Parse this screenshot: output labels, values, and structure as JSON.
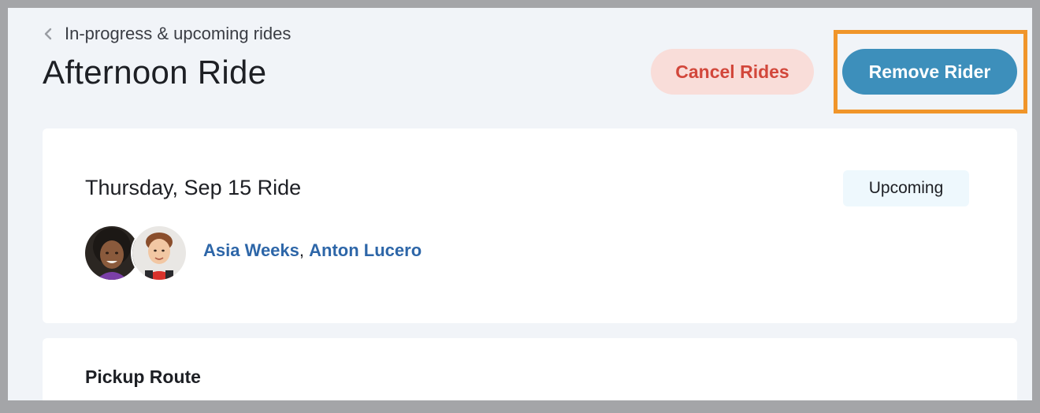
{
  "header": {
    "back_label": "In-progress & upcoming rides",
    "title": "Afternoon Ride"
  },
  "actions": {
    "cancel_label": "Cancel Rides",
    "remove_label": "Remove Rider"
  },
  "ride": {
    "date_title": "Thursday, Sep 15 Ride",
    "status": "Upcoming",
    "riders": [
      {
        "name": "Asia Weeks"
      },
      {
        "name": "Anton Lucero"
      }
    ],
    "separator": ", "
  },
  "route": {
    "title": "Pickup Route"
  },
  "colors": {
    "accent": "#3d8fbb",
    "danger": "#d2473b",
    "danger_bg": "#f9ddd9",
    "link": "#2d66a8",
    "highlight": "#f0952a",
    "page_bg": "#f1f4f8"
  },
  "icons": {
    "back": "chevron-left-icon"
  }
}
